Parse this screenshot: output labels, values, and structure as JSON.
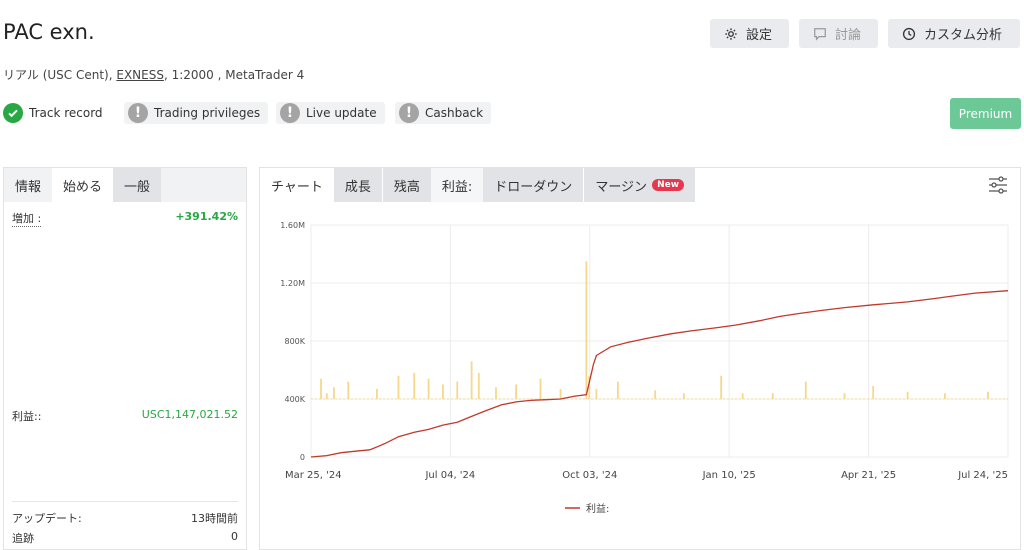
{
  "header": {
    "title": "PAC exn.",
    "subtitle_prefix": "リアル (USC Cent), ",
    "subtitle_link": "EXNESS",
    "subtitle_suffix": ", 1:2000 , MetaTrader 4",
    "buttons": {
      "settings": "設定",
      "discuss": "討論",
      "custom_analysis": "カスタム分析"
    },
    "icons": [
      "gear-icon",
      "comment-icon",
      "clock-icon"
    ]
  },
  "badges": [
    {
      "label": "Track record",
      "status": "ok"
    },
    {
      "label": "Trading privileges",
      "status": "warn"
    },
    {
      "label": "Live update",
      "status": "warn"
    },
    {
      "label": "Cashback",
      "status": "warn"
    }
  ],
  "premium_label": "Premium",
  "left_panel": {
    "tabs": [
      "情報",
      "始める",
      "一般"
    ],
    "active_tab": "始める",
    "gain_label": "増加 :",
    "gain_value": "+391.42%",
    "profit_label": "利益::",
    "profit_value": "USC1,147,021.52",
    "update_label": "アップデート:",
    "update_value": "13時間前",
    "tracking_label": "追跡",
    "tracking_value": "0"
  },
  "right_panel": {
    "tabs": [
      "チャート",
      "成長",
      "残高",
      "利益:",
      "ドローダウン",
      "マージン"
    ],
    "active_tab": "利益:",
    "new_badge": "New"
  },
  "colors": {
    "profit_line": "#c0392b",
    "volume_bars": "#f5d88a",
    "gain_green": "#27a844",
    "premium": "#6cc896"
  },
  "chart_data": {
    "type": "line",
    "title": "",
    "x_ticks": [
      "Mar 25, '24",
      "Jul 04, '24",
      "Oct 03, '24",
      "Jan 10, '25",
      "Apr 21, '25",
      "Jul 24, '25"
    ],
    "y_ticks": [
      "1.60M",
      "1.20M",
      "800K",
      "400K",
      "0"
    ],
    "ylim": [
      0,
      1600000
    ],
    "xlim": [
      "2024-03-25",
      "2025-07-24"
    ],
    "legend": "利益:",
    "series": [
      {
        "name": "利益:",
        "type": "line",
        "x": [
          "2024-03-25",
          "2024-04-05",
          "2024-04-15",
          "2024-04-25",
          "2024-05-05",
          "2024-05-15",
          "2024-05-25",
          "2024-06-05",
          "2024-06-15",
          "2024-06-25",
          "2024-07-05",
          "2024-07-15",
          "2024-07-25",
          "2024-08-05",
          "2024-08-15",
          "2024-08-25",
          "2024-09-05",
          "2024-09-15",
          "2024-09-25",
          "2024-10-03",
          "2024-10-08",
          "2024-10-10",
          "2024-10-20",
          "2024-11-01",
          "2024-11-15",
          "2024-12-01",
          "2024-12-15",
          "2025-01-01",
          "2025-01-15",
          "2025-02-01",
          "2025-02-15",
          "2025-03-01",
          "2025-03-15",
          "2025-04-01",
          "2025-04-21",
          "2025-05-15",
          "2025-06-01",
          "2025-06-15",
          "2025-07-01",
          "2025-07-24"
        ],
        "y": [
          0,
          10000,
          30000,
          40000,
          50000,
          90000,
          140000,
          170000,
          190000,
          220000,
          240000,
          280000,
          320000,
          360000,
          380000,
          390000,
          395000,
          400000,
          420000,
          430000,
          640000,
          700000,
          760000,
          790000,
          820000,
          850000,
          870000,
          890000,
          910000,
          940000,
          970000,
          990000,
          1010000,
          1030000,
          1050000,
          1070000,
          1090000,
          1110000,
          1130000,
          1147021
        ]
      },
      {
        "name": "",
        "type": "bar",
        "note_values": "daily profit bars around the 400K baseline",
        "x": [
          "2024-04-01",
          "2024-04-05",
          "2024-04-10",
          "2024-04-20",
          "2024-05-10",
          "2024-05-25",
          "2024-06-05",
          "2024-06-15",
          "2024-06-25",
          "2024-07-05",
          "2024-07-15",
          "2024-07-20",
          "2024-08-01",
          "2024-08-15",
          "2024-09-01",
          "2024-09-15",
          "2024-10-03",
          "2024-10-05",
          "2024-10-10",
          "2024-10-25",
          "2024-11-20",
          "2024-12-10",
          "2025-01-05",
          "2025-01-20",
          "2025-02-10",
          "2025-03-05",
          "2025-04-01",
          "2025-04-21",
          "2025-05-15",
          "2025-06-10",
          "2025-07-10"
        ],
        "y": [
          540000,
          440000,
          480000,
          520000,
          470000,
          560000,
          580000,
          540000,
          500000,
          520000,
          660000,
          580000,
          480000,
          500000,
          540000,
          470000,
          1350000,
          560000,
          470000,
          520000,
          460000,
          440000,
          560000,
          440000,
          440000,
          520000,
          440000,
          490000,
          450000,
          440000,
          450000
        ]
      }
    ]
  }
}
